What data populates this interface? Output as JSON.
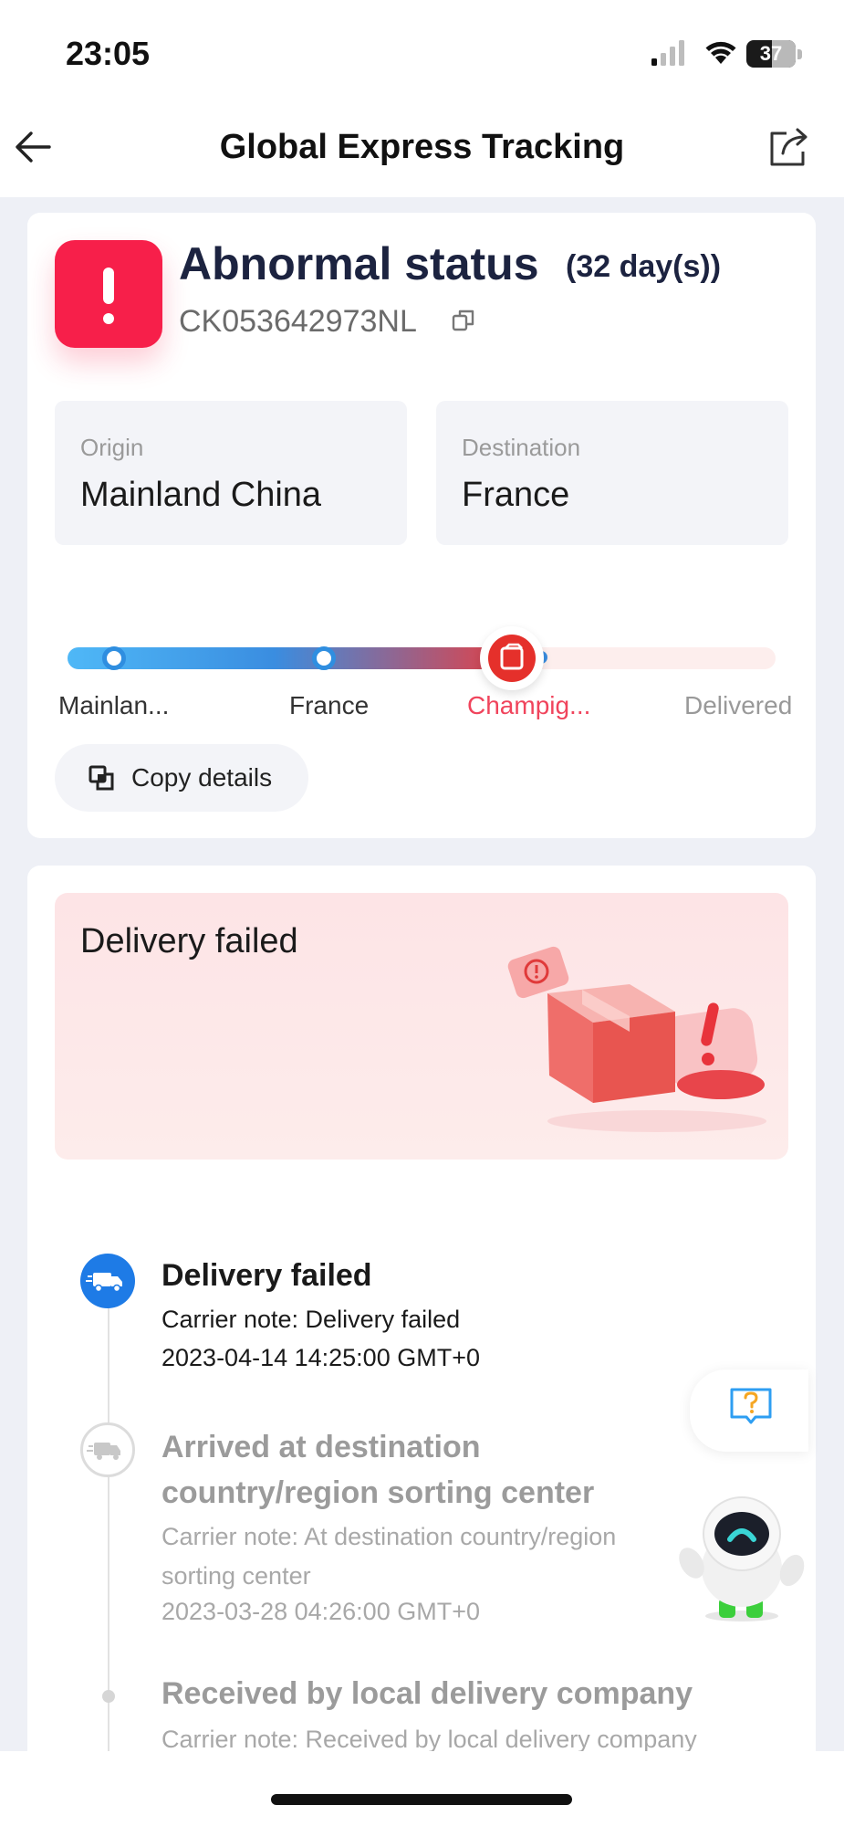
{
  "status_bar": {
    "time": "23:05",
    "battery": "37",
    "signal_icon": "cellular-signal-icon",
    "wifi_icon": "wifi-icon",
    "battery_icon": "battery-icon"
  },
  "navbar": {
    "title": "Global Express Tracking",
    "back_icon": "arrow-left-icon",
    "share_icon": "share-icon"
  },
  "summary": {
    "status": "Abnormal status",
    "days": "(32 day(s))",
    "tracking_number": "CK053642973NL",
    "status_color": "#f71f4a",
    "origin_label": "Origin",
    "origin": "Mainland China",
    "destination_label": "Destination",
    "destination": "France",
    "progress_fraction": 0.65,
    "stops": [
      "Mainlan...",
      "France",
      "Champig...",
      "Delivered"
    ],
    "copy_details_label": "Copy details"
  },
  "banner": {
    "title": "Delivery failed"
  },
  "events": [
    {
      "title": "Delivery failed",
      "note": "Carrier note: Delivery failed",
      "time": "2023-04-14 14:25:00 GMT+0"
    },
    {
      "title": "Arrived at destination country/region sorting center",
      "note": "Carrier note: At destination country/region sorting center",
      "time": "2023-03-28 04:26:00 GMT+0"
    },
    {
      "title": "Received by local delivery company",
      "note": "Carrier note: Received by local delivery company"
    }
  ],
  "colors": {
    "accent_blue": "#1e7be6",
    "alert_red": "#f71f4a",
    "current_stop_pink": "#f0445c"
  }
}
